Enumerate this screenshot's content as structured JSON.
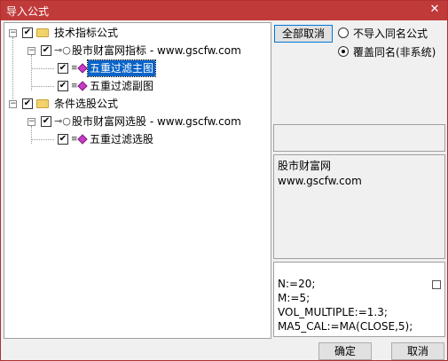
{
  "window": {
    "title": "导入公式"
  },
  "tree": {
    "root1": {
      "label": "技术指标公式"
    },
    "child1": {
      "label": "股市财富网指标 - www.gscfw.com"
    },
    "leaf1": {
      "label": "五重过滤主图"
    },
    "leaf2": {
      "label": "五重过滤副图"
    },
    "root2": {
      "label": "条件选股公式"
    },
    "child2": {
      "label": "股市财富网选股 - www.gscfw.com"
    },
    "leaf3": {
      "label": "五重过滤选股"
    }
  },
  "options": {
    "deselect_all": "全部取消",
    "no_import_same_name": "不导入同名公式",
    "overwrite_same_name": "覆盖同名(非系统)",
    "selected": "overwrite"
  },
  "description": {
    "line1": "股市财富网",
    "line2": "www.gscfw.com"
  },
  "formula": {
    "lines": [
      "N:=20;",
      "M:=5;",
      "VOL_MULTIPLE:=1.3;",
      "MA5_CAL:=MA(CLOSE,5);"
    ]
  },
  "buttons": {
    "ok": "确定",
    "cancel": "取消"
  },
  "colors": {
    "titlebar": "#c13a3a",
    "selection": "#0a64c8"
  }
}
